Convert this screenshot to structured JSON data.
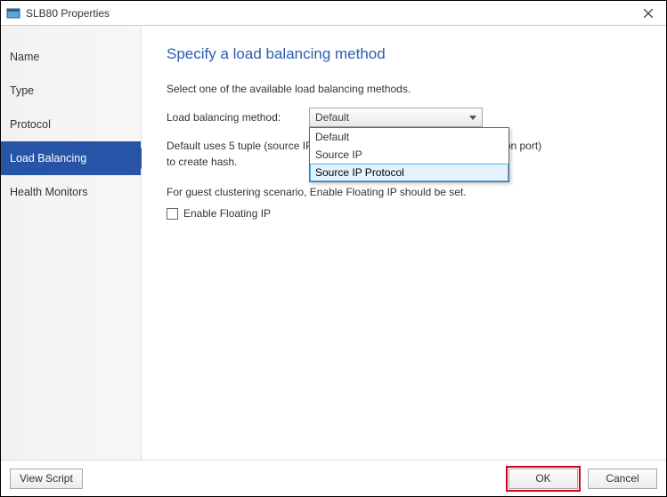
{
  "titlebar": {
    "title": "SLB80 Properties"
  },
  "sidebar": {
    "items": [
      {
        "label": "Name"
      },
      {
        "label": "Type"
      },
      {
        "label": "Protocol"
      },
      {
        "label": "Load Balancing"
      },
      {
        "label": "Health Monitors"
      }
    ],
    "selected_index": 3
  },
  "content": {
    "heading": "Specify a load balancing method",
    "description": "Select one of the available load balancing methods.",
    "field_label": "Load balancing method:",
    "combo_value": "Default",
    "dropdown_options": [
      "Default",
      "Source IP",
      "Source IP Protocol"
    ],
    "hovered_option_index": 2,
    "hint_text": "Default uses 5 tuple (source IP, source port, destination IP and destination port) to create hash.",
    "hint_text_visible_prefix": "Default uses 5 tuple (source",
    "hint_text_visible_suffix": "IP and destination port) to create h",
    "floating_hint": "For guest clustering scenario, Enable Floating IP should be set.",
    "checkbox_label": "Enable Floating IP",
    "checkbox_checked": false
  },
  "footer": {
    "view_script": "View Script",
    "ok": "OK",
    "cancel": "Cancel"
  }
}
